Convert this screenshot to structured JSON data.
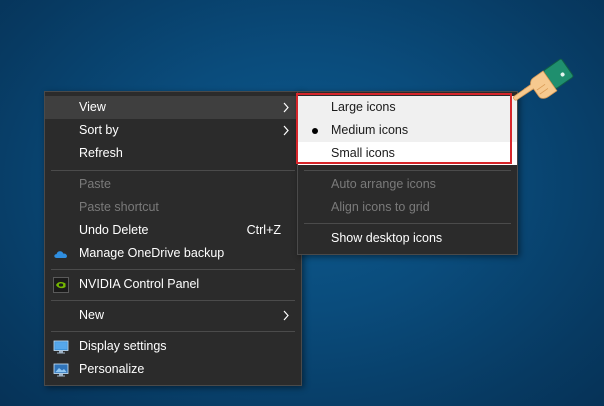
{
  "main_menu": {
    "items": [
      {
        "label": "View",
        "shortcut": "",
        "has_submenu": true,
        "disabled": false,
        "icon": ""
      },
      {
        "label": "Sort by",
        "shortcut": "",
        "has_submenu": true,
        "disabled": false,
        "icon": ""
      },
      {
        "label": "Refresh",
        "shortcut": "",
        "has_submenu": false,
        "disabled": false,
        "icon": ""
      },
      {
        "label": "Paste",
        "shortcut": "",
        "has_submenu": false,
        "disabled": true,
        "icon": ""
      },
      {
        "label": "Paste shortcut",
        "shortcut": "",
        "has_submenu": false,
        "disabled": true,
        "icon": ""
      },
      {
        "label": "Undo Delete",
        "shortcut": "Ctrl+Z",
        "has_submenu": false,
        "disabled": false,
        "icon": ""
      },
      {
        "label": "Manage OneDrive backup",
        "shortcut": "",
        "has_submenu": false,
        "disabled": false,
        "icon": "onedrive-cloud-icon"
      },
      {
        "label": "NVIDIA Control Panel",
        "shortcut": "",
        "has_submenu": false,
        "disabled": false,
        "icon": "nvidia-icon"
      },
      {
        "label": "New",
        "shortcut": "",
        "has_submenu": true,
        "disabled": false,
        "icon": ""
      },
      {
        "label": "Display settings",
        "shortcut": "",
        "has_submenu": false,
        "disabled": false,
        "icon": "display-settings-icon"
      },
      {
        "label": "Personalize",
        "shortcut": "",
        "has_submenu": false,
        "disabled": false,
        "icon": "personalize-icon"
      }
    ]
  },
  "view_submenu": {
    "items": [
      {
        "label": "Large icons",
        "checked": false,
        "disabled": false
      },
      {
        "label": "Medium icons",
        "checked": true,
        "disabled": false
      },
      {
        "label": "Small icons",
        "checked": false,
        "disabled": false
      },
      {
        "label": "Auto arrange icons",
        "checked": false,
        "disabled": true
      },
      {
        "label": "Align icons to grid",
        "checked": false,
        "disabled": true
      },
      {
        "label": "Show desktop icons",
        "checked": false,
        "disabled": false
      }
    ]
  },
  "colors": {
    "desktop_background": "#0a4c7c",
    "menu_background": "#2b2b2b",
    "highlight_box": "#d6262b",
    "onedrive_blue": "#2f8ee0",
    "nvidia_green": "#76b900"
  },
  "annotation": {
    "pointer_icon": "pointing-hand-icon"
  }
}
